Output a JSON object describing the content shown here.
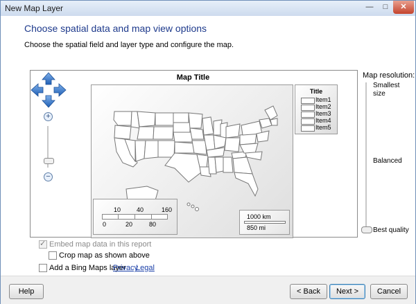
{
  "window": {
    "title": "New Map Layer",
    "min_icon": "minimize-icon",
    "max_icon": "maximize-icon",
    "close_icon": "close-icon"
  },
  "header": {
    "title": "Choose spatial data and map view options",
    "subtitle": "Choose the spatial field and layer type and configure the map."
  },
  "map": {
    "title": "Map Title",
    "legend_title": "Title",
    "legend_items": [
      "Item1",
      "Item2",
      "Item3",
      "Item4",
      "Item5"
    ],
    "color_scale": {
      "top": [
        "10",
        "40",
        "160"
      ],
      "bottom": [
        "0",
        "20",
        "80"
      ]
    },
    "distance_scale": {
      "km": "1000 km",
      "mi": "850 mi"
    }
  },
  "resolution": {
    "label": "Map resolution:",
    "options": [
      "Smallest size",
      "Balanced",
      "Best quality"
    ],
    "selected": "Best quality"
  },
  "options": {
    "embed": {
      "label": "Embed map data in this report",
      "checked": true,
      "enabled": false
    },
    "crop": {
      "label": "Crop map as shown above",
      "checked": false
    },
    "bing": {
      "label": "Add a Bing Maps layer",
      "checked": false
    },
    "privacy": "Privacy",
    "legal": "Legal"
  },
  "buttons": {
    "help": "Help",
    "back": "< Back",
    "next": "Next >",
    "cancel": "Cancel"
  }
}
